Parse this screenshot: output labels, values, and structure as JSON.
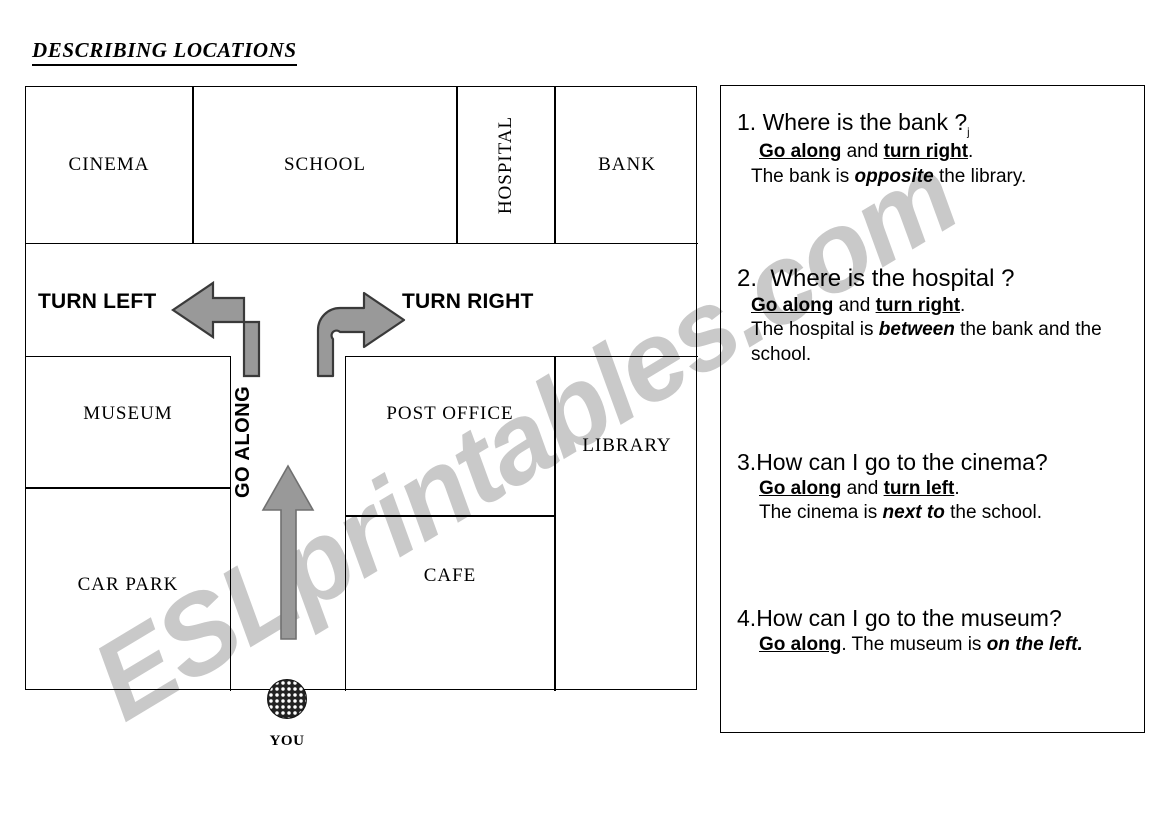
{
  "title": "DESCRIBING LOCATIONS",
  "watermark": "ESLprintables.com",
  "map": {
    "blocks": [
      {
        "id": "cinema",
        "label": "CINEMA"
      },
      {
        "id": "school",
        "label": "SCHOOL"
      },
      {
        "id": "hospital",
        "label": "HOSPITAL"
      },
      {
        "id": "bank",
        "label": "BANK"
      },
      {
        "id": "museum",
        "label": "MUSEUM"
      },
      {
        "id": "carpark",
        "label": "CAR PARK"
      },
      {
        "id": "post",
        "label": "POST OFFICE"
      },
      {
        "id": "cafe",
        "label": "CAFE"
      },
      {
        "id": "library",
        "label": "LIBRARY"
      }
    ],
    "directions": {
      "turn_left": "TURN LEFT",
      "turn_right": "TURN RIGHT",
      "go_along": "GO ALONG"
    },
    "you_label": "YOU",
    "arrow_fill": "#999999",
    "arrow_stroke": "#333333"
  },
  "questions": [
    {
      "number": "1.",
      "question": "Where is the bank ?",
      "question_suffix": "j",
      "answer_line1": {
        "b1": "Go along",
        "mid": " and ",
        "b2": "turn right",
        "end": "."
      },
      "answer_line2": {
        "pre": "The bank is ",
        "em": "opposite",
        "post": " the library."
      }
    },
    {
      "number": "2.",
      "question": "Where is the hospital ?",
      "question_suffix": "",
      "answer_line1": {
        "b1": "Go along",
        "mid": " and ",
        "b2": "turn right",
        "end": "."
      },
      "answer_line2": {
        "pre": "The hospital is ",
        "em": "between",
        "post": " the bank and the school."
      }
    },
    {
      "number": "3.",
      "question": "How can I go to the cinema?",
      "question_suffix": "",
      "answer_line1": {
        "b1": "Go along",
        "mid": " and ",
        "b2": "turn left",
        "end": "."
      },
      "answer_line2": {
        "pre": "The cinema is ",
        "em": "next to",
        "post": " the school."
      }
    },
    {
      "number": "4.",
      "question": "How can I go to the museum?",
      "question_suffix": "",
      "answer_line1": {
        "b1": "Go along",
        "mid": "",
        "b2": "",
        "end": "."
      },
      "answer_line2": {
        "pre": "  The museum is ",
        "em": "on the left.",
        "post": ""
      }
    }
  ]
}
